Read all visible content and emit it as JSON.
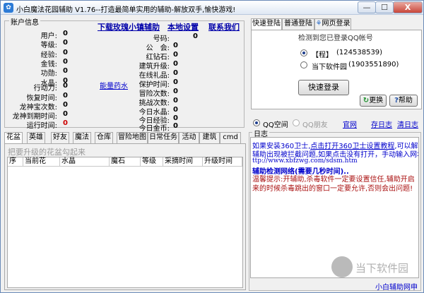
{
  "app": {
    "title": "小白魔法花园辅助 V1.76--打造最简单实用的辅助-解放双手,愉快游戏!",
    "window_buttons": {
      "minimize": "—",
      "maximize": "☐",
      "close": "X"
    }
  },
  "account": {
    "legend": "账户信息",
    "links": {
      "download": "下载玫瑰小镇辅助",
      "local": "本地设置",
      "contact": "联系我们"
    },
    "left_fields": [
      {
        "label": "用户:",
        "value": "0"
      },
      {
        "label": "等级:",
        "value": "0"
      },
      {
        "label": "经验:",
        "value": "0"
      },
      {
        "label": "金钱:",
        "value": "0"
      },
      {
        "label": "功勋:",
        "value": "0"
      },
      {
        "label": "水晶:",
        "value": "0"
      },
      {
        "label": "行动力:",
        "value": "0"
      },
      {
        "label": "恢复时间:",
        "value": "0"
      },
      {
        "label": "龙神宝次数:",
        "value": "0"
      },
      {
        "label": "龙神到期时间:",
        "value": "0"
      },
      {
        "label": "运行时间:",
        "value": "0"
      }
    ],
    "energy_potion": "能量药水",
    "right_fields": [
      {
        "label": "号码:",
        "value": "0"
      },
      {
        "label": "公　会:",
        "value": "0"
      },
      {
        "label": "红钻石:",
        "value": "0"
      },
      {
        "label": "建筑升级:",
        "value": "0"
      },
      {
        "label": "在线礼品:",
        "value": "0"
      },
      {
        "label": "保护时间:",
        "value": "0"
      },
      {
        "label": "冒险次数:",
        "value": "0"
      },
      {
        "label": "挑战次数:",
        "value": "0"
      },
      {
        "label": "今日水晶:",
        "value": "0"
      },
      {
        "label": "今日经验:",
        "value": "0"
      },
      {
        "label": "今日金币:",
        "value": "0"
      }
    ]
  },
  "main_tabs": [
    "花盆",
    "英雄",
    "好友",
    "魔法",
    "仓库",
    "冒险地图",
    "日常任务",
    "活动",
    "建筑",
    "cmd"
  ],
  "pot": {
    "hint": "把要升级的花盆勾起来",
    "columns": [
      "序",
      "当前花",
      "水晶",
      "魔石",
      "等级",
      "采摘时间",
      "升级时间"
    ]
  },
  "login": {
    "tabs": [
      "快速登陆",
      "普通登陆",
      "网页登录"
    ],
    "detected": "检测到您已登录QQ帐号",
    "accounts": [
      {
        "name": "【程】",
        "number": "(124538539)",
        "selected": true
      },
      {
        "name": "当下软件园",
        "number": "(1903551890)",
        "selected": false
      }
    ],
    "quick_login": "快速登录",
    "change": "更换",
    "help": "帮助"
  },
  "space": {
    "options": [
      "QQ空间",
      "QQ朋友"
    ],
    "selected": 0,
    "links": [
      "官网",
      "存日志",
      "清日志"
    ]
  },
  "log": {
    "legend": "日志",
    "lines": [
      {
        "parts": [
          {
            "text": "如果安装360卫士,",
            "color": "#0000cc"
          },
          {
            "text": "点击打开360卫士设置教程",
            "color": "#0000cc",
            "link": true
          },
          {
            "text": ",可以解决",
            "color": "#0000cc"
          }
        ]
      },
      {
        "parts": [
          {
            "text": "辅助出现被拦截问题,如果点击没有打开，手动输入网址:h",
            "color": "#0000cc"
          }
        ]
      },
      {
        "parts": [
          {
            "text": "ttp://www.xbfzwg.com/sdsm.htm",
            "color": "#0000cc",
            "small": true
          }
        ]
      },
      {
        "parts": [
          {
            "text": "辅助检测网络(需要几秒时间)..",
            "color": "#0000cc",
            "bold": true
          }
        ]
      },
      {
        "parts": [
          {
            "text": "温馨提示:开辅助,杀毒软件一定要设置信任,辅助开启",
            "color": "#aa1111"
          }
        ]
      },
      {
        "parts": [
          {
            "text": "来的时候杀毒跳出的窗口一定要允许,否则会出问题!",
            "color": "#aa1111"
          }
        ]
      }
    ]
  },
  "statusbar": {
    "text": "小白辅助网申"
  },
  "watermark": {
    "text": "当下软件园"
  }
}
